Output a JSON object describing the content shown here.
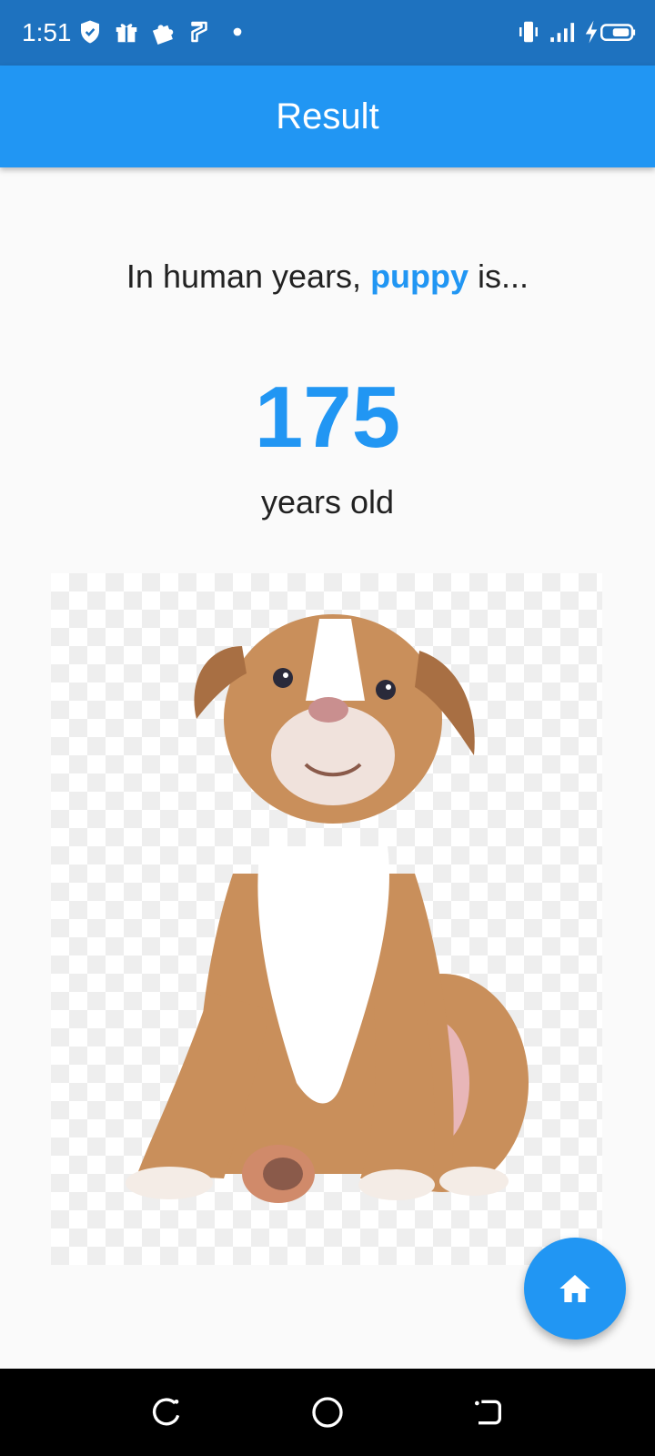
{
  "status_bar": {
    "time": "1:51",
    "left_icons": [
      "shield-icon",
      "gift-icon",
      "puzzle-icon",
      "app-icon",
      "dot-icon"
    ],
    "right_icons": [
      "vibrate-icon",
      "signal-icon",
      "charging-icon",
      "battery-icon"
    ]
  },
  "app_bar": {
    "title": "Result"
  },
  "result": {
    "intro_prefix": "In human years, ",
    "pet_name": "puppy",
    "intro_suffix": " is...",
    "age_value": "175",
    "age_unit": "years old"
  },
  "photo": {
    "subject": "puppy-photo"
  },
  "fab": {
    "icon": "home-icon"
  },
  "nav_bar": {
    "buttons": [
      "recent-apps-icon",
      "home-circle-icon",
      "back-icon"
    ]
  },
  "colors": {
    "status_bar": "#1e72bf",
    "app_bar": "#2196f3",
    "accent": "#2196f3",
    "background": "#fafafa",
    "text": "#222222"
  }
}
